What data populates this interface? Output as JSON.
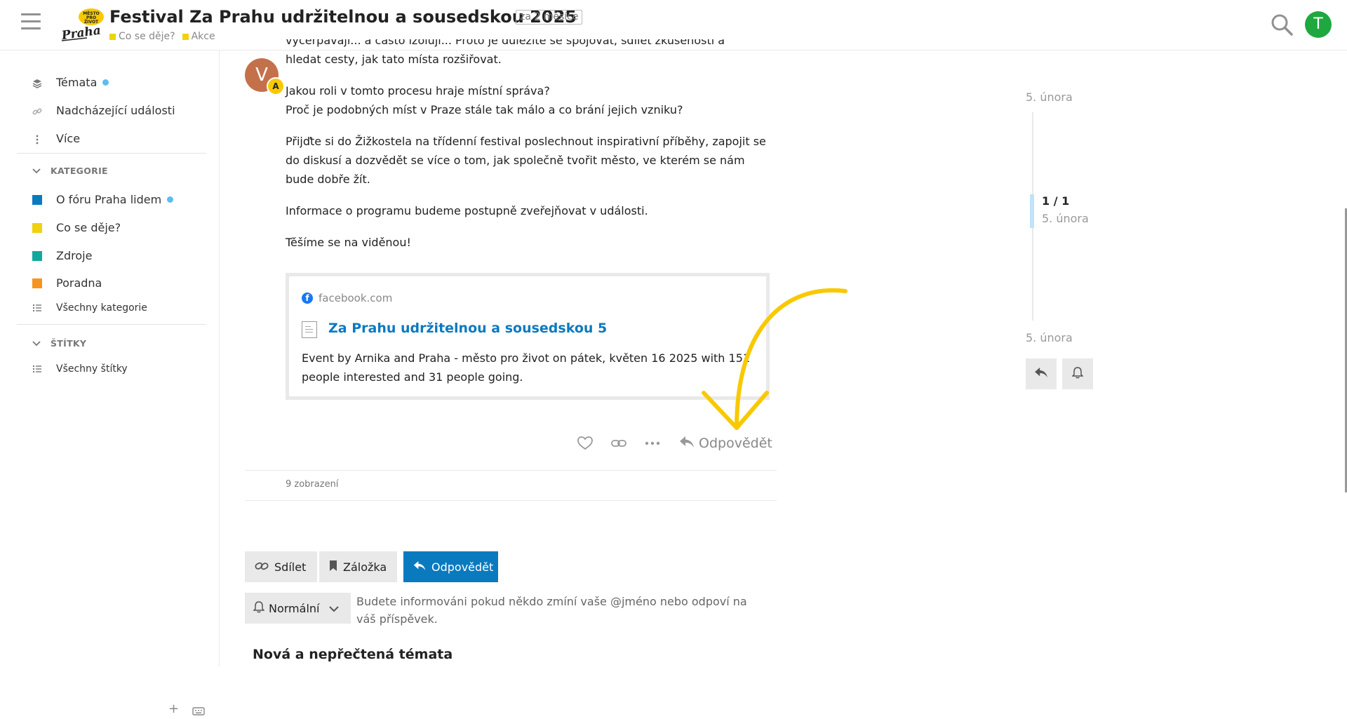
{
  "header": {
    "title": "Festival Za Prahu udržitelnou a sousedskou 2025",
    "badge": "za 2 měsíce",
    "logo_text": "Praha",
    "logo_badge": "MĚSTO PRO ŽIVOT",
    "breadcrumbs": [
      {
        "label": "Co se děje?",
        "color": "#f0d20e"
      },
      {
        "label": "Akce",
        "color": "#f0d20e"
      }
    ],
    "user_initial": "T"
  },
  "sidebar": {
    "items": [
      {
        "label": "Témata"
      },
      {
        "label": "Nadcházející události"
      },
      {
        "label": "Více"
      }
    ],
    "categories_heading": "KATEGORIE",
    "categories": [
      {
        "label": "O fóru Praha lidem",
        "color": "#0a7abf"
      },
      {
        "label": "Co se děje?",
        "color": "#f0d20e"
      },
      {
        "label": "Zdroje",
        "color": "#12a89d"
      },
      {
        "label": "Poradna",
        "color": "#f7941d"
      }
    ],
    "all_categories": "Všechny kategorie",
    "tags_heading": "ŠTÍTKY",
    "all_tags": "Všechny štítky"
  },
  "post": {
    "avatar_initial": "V",
    "avatar_badge": "A",
    "cut_line": "vyčerpávají... a často izolují... Proto je důležité se spojovat, sdílet zkušenosti a společně",
    "line_2": "hledat cesty, jak tato místa rozšiřovat.",
    "q1": "Jakou roli v tomto procesu hraje místní správa?",
    "q2": "Proč je podobných míst v Praze stále tak málo a co brání jejich vzniku?",
    "p_festival": "Přijďte si do Žižkostela na třídenní festival poslechnout inspirativní příběhy, zapojit se do diskusí a dozvědět se více o tom, jak společně tvořit město, ve kterém se nám bude dobře žít.",
    "p_info": "Informace o programu budeme postupně zveřejňovat v události.",
    "p_end": "Těšíme se na viděnou!",
    "onebox": {
      "source": "facebook.com",
      "title": "Za Prahu udržitelnou a sousedskou 5",
      "description": "Event by Arnika and Praha - město pro život on pátek, květen 16 2025 with 151 people interested and 31 people going."
    },
    "reply_label": "Odpovědět",
    "views": "9 zobrazení"
  },
  "footer_buttons": {
    "share": "Sdílet",
    "bookmark": "Záložka",
    "reply": "Odpovědět",
    "notification_level": "Normální",
    "notification_text": "Budete informováni pokud někdo zmíní vaše @jméno nebo odpoví na váš příspěvek."
  },
  "section_title": "Nová a nepřečtená témata",
  "timeline": {
    "start_date": "5. února",
    "position": "1 / 1",
    "position_date": "5. února",
    "end_date": "5. února"
  },
  "colors": {
    "accent": "#0a7abf",
    "arrow": "#f8c900"
  }
}
